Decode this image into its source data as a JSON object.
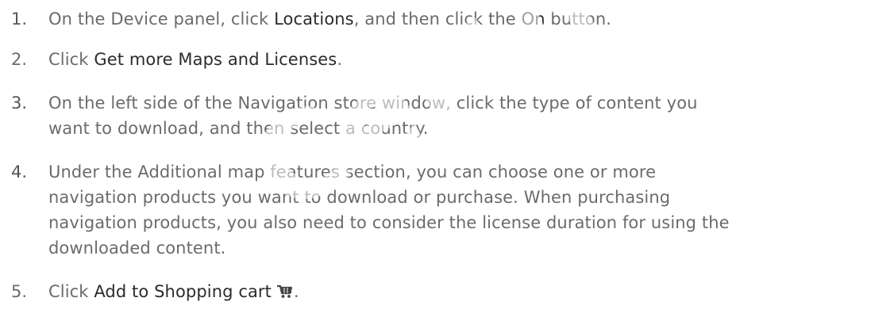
{
  "steps": [
    {
      "number": "1.",
      "lines": [
        {
          "parts": [
            "On the Device panel, click ",
            "Locations",
            ", and then click the ",
            "On",
            " button."
          ]
        }
      ]
    },
    {
      "number": "2.",
      "lines": [
        {
          "parts": [
            "Click ",
            "Get more Maps and Licenses",
            "."
          ]
        }
      ]
    },
    {
      "number": "3.",
      "lines": [
        {
          "text": "On the left side of the Navigation store window, click the type of content you"
        },
        {
          "text": "want to download, and then select a country."
        }
      ]
    },
    {
      "number": "4.",
      "lines": [
        {
          "text": "Under the Additional map features section, you can choose one or more"
        },
        {
          "text": "navigation products you want to download or purchase. When purchasing"
        },
        {
          "text": "navigation products, you also need to consider the license duration for using the"
        },
        {
          "text": "downloaded content."
        }
      ]
    },
    {
      "number": "5.",
      "lines": [
        {
          "parts": [
            "Click ",
            "Add to Shopping cart",
            "."
          ]
        }
      ],
      "icon": "shopping-cart-icon"
    }
  ],
  "watermark": "Certification",
  "colors": {
    "body_text": "#6b6b6b",
    "highlight_text": "#2b2b2b",
    "icon": "#444444"
  }
}
